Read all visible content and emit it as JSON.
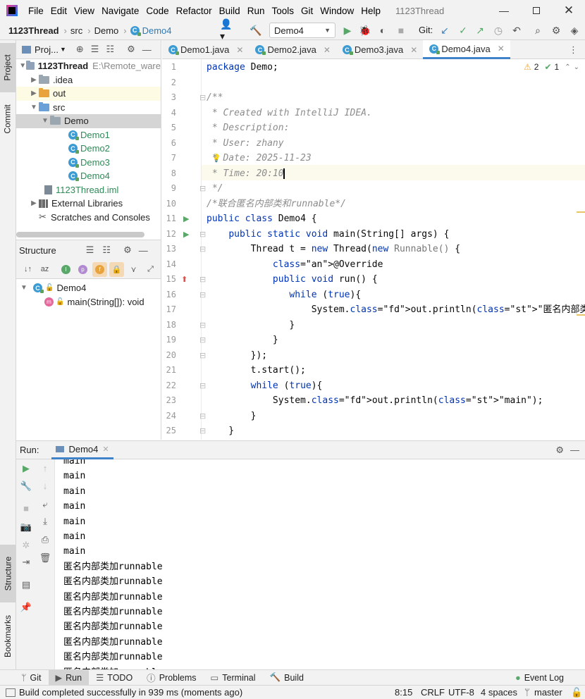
{
  "menubar": {
    "items": [
      "File",
      "Edit",
      "View",
      "Navigate",
      "Code",
      "Refactor",
      "Build",
      "Run",
      "Tools",
      "Git",
      "Window",
      "Help"
    ],
    "title": "1123Thread"
  },
  "navbar": {
    "breadcrumbs": [
      "1123Thread",
      "src",
      "Demo",
      "Demo4"
    ],
    "run_config": "Demo4",
    "git_label": "Git:"
  },
  "left_strip": {
    "project": "Project",
    "commit": "Commit",
    "structure": "Structure",
    "bookmarks": "Bookmarks"
  },
  "project": {
    "header": "Proj...",
    "rows": [
      {
        "label": "1123Thread",
        "extra": "E:\\Remote_ware"
      },
      {
        "label": ".idea"
      },
      {
        "label": "out"
      },
      {
        "label": "src"
      },
      {
        "label": "Demo"
      },
      {
        "label": "Demo1"
      },
      {
        "label": "Demo2"
      },
      {
        "label": "Demo3"
      },
      {
        "label": "Demo4"
      },
      {
        "label": "1123Thread.iml"
      },
      {
        "label": "External Libraries"
      },
      {
        "label": "Scratches and Consoles"
      }
    ]
  },
  "structure": {
    "header": "Structure",
    "class_name": "Demo4",
    "method": "main(String[]): void"
  },
  "editor": {
    "tabs": [
      "Demo1.java",
      "Demo2.java",
      "Demo3.java",
      "Demo4.java"
    ],
    "warnings": "2",
    "weak_warnings": "1",
    "lines": [
      {
        "n": "1",
        "text": "package Demo;"
      },
      {
        "n": "2",
        "text": ""
      },
      {
        "n": "3",
        "text": "/**"
      },
      {
        "n": "4",
        "text": " * Created with IntelliJ IDEA."
      },
      {
        "n": "5",
        "text": " * Description:"
      },
      {
        "n": "6",
        "text": " * User: zhany"
      },
      {
        "n": "7",
        "text": " * Date: 2025-11-23"
      },
      {
        "n": "8",
        "text": " * Time: 20:10"
      },
      {
        "n": "9",
        "text": " */"
      },
      {
        "n": "10",
        "text": "/*联合匿名内部类和runnable*/"
      },
      {
        "n": "11",
        "text": "public class Demo4 {"
      },
      {
        "n": "12",
        "text": "    public static void main(String[] args) {"
      },
      {
        "n": "13",
        "text": "        Thread t = new Thread(new Runnable() {"
      },
      {
        "n": "14",
        "text": "            @Override"
      },
      {
        "n": "15",
        "text": "            public void run() {"
      },
      {
        "n": "16",
        "text": "               while (true){"
      },
      {
        "n": "17",
        "text": "                   System.out.println(\"匿名内部类加runnable\");"
      },
      {
        "n": "18",
        "text": "               }"
      },
      {
        "n": "19",
        "text": "            }"
      },
      {
        "n": "20",
        "text": "        });"
      },
      {
        "n": "21",
        "text": "        t.start();"
      },
      {
        "n": "22",
        "text": "        while (true){"
      },
      {
        "n": "23",
        "text": "            System.out.println(\"main\");"
      },
      {
        "n": "24",
        "text": "        }"
      },
      {
        "n": "25",
        "text": "    }"
      }
    ]
  },
  "run": {
    "label": "Run:",
    "tab": "Demo4",
    "output": [
      "main",
      "main",
      "main",
      "main",
      "main",
      "main",
      "main",
      "匿名内部类加runnable",
      "匿名内部类加runnable",
      "匿名内部类加runnable",
      "匿名内部类加runnable",
      "匿名内部类加runnable",
      "匿名内部类加runnable",
      "匿名内部类加runnable",
      "匿名内部类加runnable"
    ]
  },
  "bottom_tabs": {
    "git": "Git",
    "run": "Run",
    "todo": "TODO",
    "problems": "Problems",
    "terminal": "Terminal",
    "build": "Build",
    "event_log": "Event Log"
  },
  "status": {
    "message": "Build completed successfully in 939 ms (moments ago)",
    "position": "8:15",
    "line_sep": "CRLF",
    "encoding": "UTF-8",
    "indent": "4 spaces",
    "branch": "master"
  },
  "colors": {
    "accent": "#4083c9",
    "run_green": "#59a869",
    "keyword": "#0033b3",
    "string": "#067d17"
  }
}
